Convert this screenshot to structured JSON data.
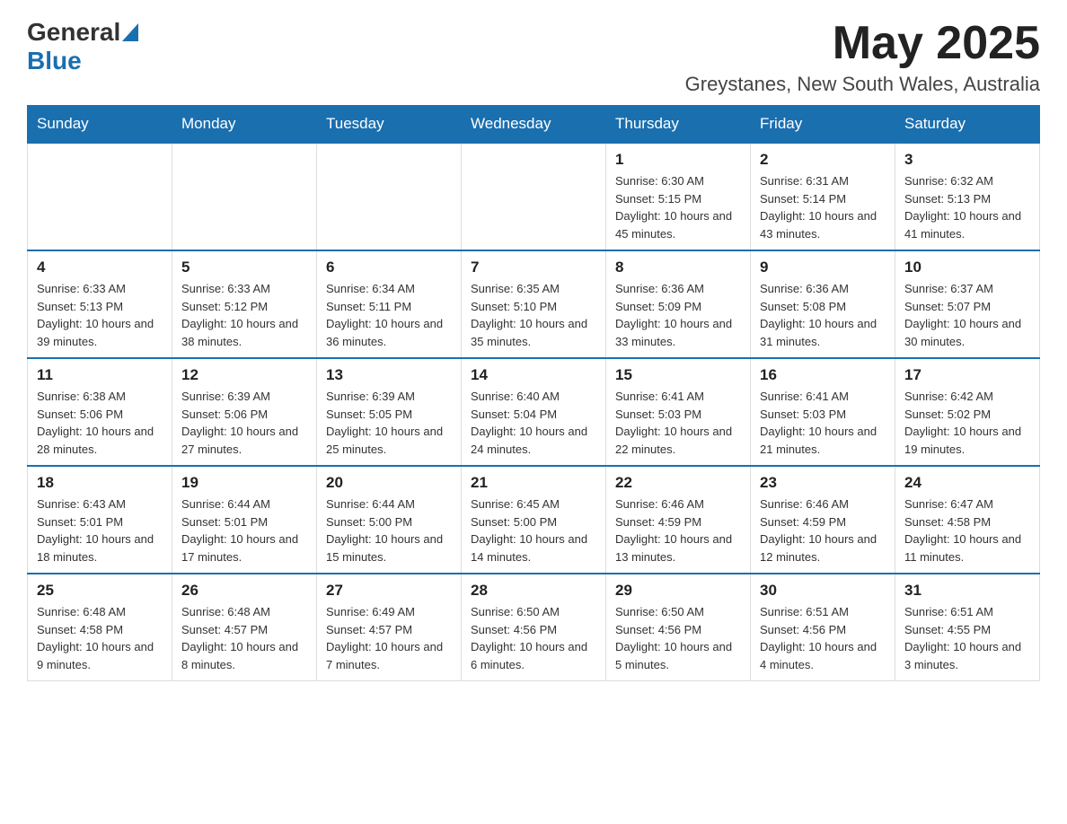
{
  "header": {
    "logo_general": "General",
    "logo_blue": "Blue",
    "month_year": "May 2025",
    "location": "Greystanes, New South Wales, Australia"
  },
  "days_of_week": [
    "Sunday",
    "Monday",
    "Tuesday",
    "Wednesday",
    "Thursday",
    "Friday",
    "Saturday"
  ],
  "weeks": [
    [
      {
        "day": "",
        "info": ""
      },
      {
        "day": "",
        "info": ""
      },
      {
        "day": "",
        "info": ""
      },
      {
        "day": "",
        "info": ""
      },
      {
        "day": "1",
        "info": "Sunrise: 6:30 AM\nSunset: 5:15 PM\nDaylight: 10 hours and 45 minutes."
      },
      {
        "day": "2",
        "info": "Sunrise: 6:31 AM\nSunset: 5:14 PM\nDaylight: 10 hours and 43 minutes."
      },
      {
        "day": "3",
        "info": "Sunrise: 6:32 AM\nSunset: 5:13 PM\nDaylight: 10 hours and 41 minutes."
      }
    ],
    [
      {
        "day": "4",
        "info": "Sunrise: 6:33 AM\nSunset: 5:13 PM\nDaylight: 10 hours and 39 minutes."
      },
      {
        "day": "5",
        "info": "Sunrise: 6:33 AM\nSunset: 5:12 PM\nDaylight: 10 hours and 38 minutes."
      },
      {
        "day": "6",
        "info": "Sunrise: 6:34 AM\nSunset: 5:11 PM\nDaylight: 10 hours and 36 minutes."
      },
      {
        "day": "7",
        "info": "Sunrise: 6:35 AM\nSunset: 5:10 PM\nDaylight: 10 hours and 35 minutes."
      },
      {
        "day": "8",
        "info": "Sunrise: 6:36 AM\nSunset: 5:09 PM\nDaylight: 10 hours and 33 minutes."
      },
      {
        "day": "9",
        "info": "Sunrise: 6:36 AM\nSunset: 5:08 PM\nDaylight: 10 hours and 31 minutes."
      },
      {
        "day": "10",
        "info": "Sunrise: 6:37 AM\nSunset: 5:07 PM\nDaylight: 10 hours and 30 minutes."
      }
    ],
    [
      {
        "day": "11",
        "info": "Sunrise: 6:38 AM\nSunset: 5:06 PM\nDaylight: 10 hours and 28 minutes."
      },
      {
        "day": "12",
        "info": "Sunrise: 6:39 AM\nSunset: 5:06 PM\nDaylight: 10 hours and 27 minutes."
      },
      {
        "day": "13",
        "info": "Sunrise: 6:39 AM\nSunset: 5:05 PM\nDaylight: 10 hours and 25 minutes."
      },
      {
        "day": "14",
        "info": "Sunrise: 6:40 AM\nSunset: 5:04 PM\nDaylight: 10 hours and 24 minutes."
      },
      {
        "day": "15",
        "info": "Sunrise: 6:41 AM\nSunset: 5:03 PM\nDaylight: 10 hours and 22 minutes."
      },
      {
        "day": "16",
        "info": "Sunrise: 6:41 AM\nSunset: 5:03 PM\nDaylight: 10 hours and 21 minutes."
      },
      {
        "day": "17",
        "info": "Sunrise: 6:42 AM\nSunset: 5:02 PM\nDaylight: 10 hours and 19 minutes."
      }
    ],
    [
      {
        "day": "18",
        "info": "Sunrise: 6:43 AM\nSunset: 5:01 PM\nDaylight: 10 hours and 18 minutes."
      },
      {
        "day": "19",
        "info": "Sunrise: 6:44 AM\nSunset: 5:01 PM\nDaylight: 10 hours and 17 minutes."
      },
      {
        "day": "20",
        "info": "Sunrise: 6:44 AM\nSunset: 5:00 PM\nDaylight: 10 hours and 15 minutes."
      },
      {
        "day": "21",
        "info": "Sunrise: 6:45 AM\nSunset: 5:00 PM\nDaylight: 10 hours and 14 minutes."
      },
      {
        "day": "22",
        "info": "Sunrise: 6:46 AM\nSunset: 4:59 PM\nDaylight: 10 hours and 13 minutes."
      },
      {
        "day": "23",
        "info": "Sunrise: 6:46 AM\nSunset: 4:59 PM\nDaylight: 10 hours and 12 minutes."
      },
      {
        "day": "24",
        "info": "Sunrise: 6:47 AM\nSunset: 4:58 PM\nDaylight: 10 hours and 11 minutes."
      }
    ],
    [
      {
        "day": "25",
        "info": "Sunrise: 6:48 AM\nSunset: 4:58 PM\nDaylight: 10 hours and 9 minutes."
      },
      {
        "day": "26",
        "info": "Sunrise: 6:48 AM\nSunset: 4:57 PM\nDaylight: 10 hours and 8 minutes."
      },
      {
        "day": "27",
        "info": "Sunrise: 6:49 AM\nSunset: 4:57 PM\nDaylight: 10 hours and 7 minutes."
      },
      {
        "day": "28",
        "info": "Sunrise: 6:50 AM\nSunset: 4:56 PM\nDaylight: 10 hours and 6 minutes."
      },
      {
        "day": "29",
        "info": "Sunrise: 6:50 AM\nSunset: 4:56 PM\nDaylight: 10 hours and 5 minutes."
      },
      {
        "day": "30",
        "info": "Sunrise: 6:51 AM\nSunset: 4:56 PM\nDaylight: 10 hours and 4 minutes."
      },
      {
        "day": "31",
        "info": "Sunrise: 6:51 AM\nSunset: 4:55 PM\nDaylight: 10 hours and 3 minutes."
      }
    ]
  ]
}
